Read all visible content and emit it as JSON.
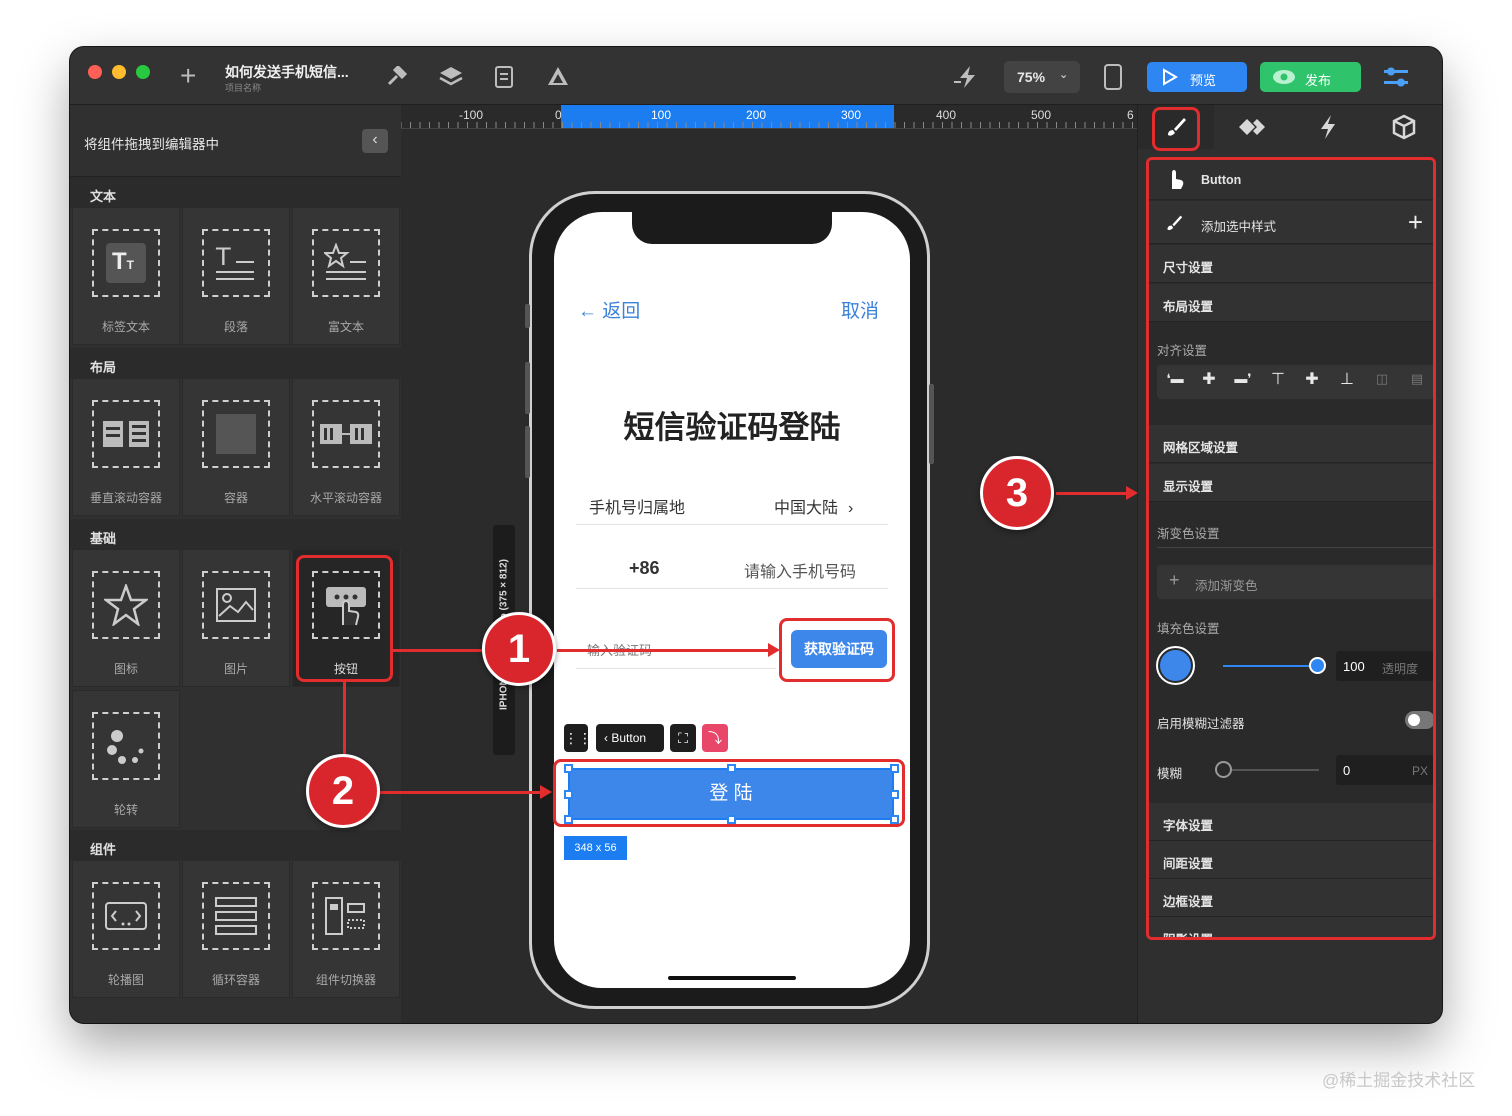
{
  "titlebar": {
    "project_title": "如何发送手机短信...",
    "project_subtitle": "项目名称",
    "zoom": "75%",
    "preview": "预览",
    "publish": "发布"
  },
  "left_panel": {
    "header": "将组件拖拽到编辑器中",
    "sections": {
      "text": "文本",
      "layout": "布局",
      "basic": "基础",
      "components": "组件"
    },
    "tiles": {
      "label_text": "标签文本",
      "paragraph": "段落",
      "rich_text": "富文本",
      "vscroll": "垂直滚动容器",
      "container": "容器",
      "hscroll": "水平滚动容器",
      "icon": "图标",
      "image": "图片",
      "button": "按钮",
      "spinner": "轮转",
      "carousel": "轮播图",
      "loop": "循环容器",
      "switcher": "组件切换器"
    }
  },
  "ruler": {
    "labels": [
      "-100",
      "0",
      "100",
      "200",
      "300",
      "400",
      "500",
      "6"
    ]
  },
  "device_label": "IPHONE X/XS/11 Pro (375 × 812)",
  "phone": {
    "back": "返回",
    "cancel": "取消",
    "title": "短信验证码登陆",
    "region_label": "手机号归属地",
    "region_value": "中国大陆",
    "country_code": "+86",
    "phone_placeholder": "请输入手机号码",
    "code_placeholder": "输入验证码",
    "get_code": "获取验证码",
    "login": "登 陆",
    "size_badge": "348 x 56",
    "toolbar_button": "Button"
  },
  "right_panel": {
    "component": "Button",
    "add_style": "添加选中样式",
    "size": "尺寸设置",
    "layout": "布局设置",
    "align": "对齐设置",
    "grid": "网格区域设置",
    "display": "显示设置",
    "gradient": "渐变色设置",
    "add_gradient": "添加渐变色",
    "fill": "填充色设置",
    "opacity_value": "100",
    "opacity_label": "透明度",
    "blur_filter": "启用模糊过滤器",
    "blur": "模糊",
    "blur_value": "0",
    "blur_unit": "PX",
    "font": "字体设置",
    "spacing": "间距设置",
    "border": "边框设置",
    "shadow": "阴影设置",
    "fill_color": "#3d86ea"
  },
  "callouts": {
    "one": "1",
    "two": "2",
    "three": "3"
  },
  "watermark": "@稀土掘金技术社区"
}
